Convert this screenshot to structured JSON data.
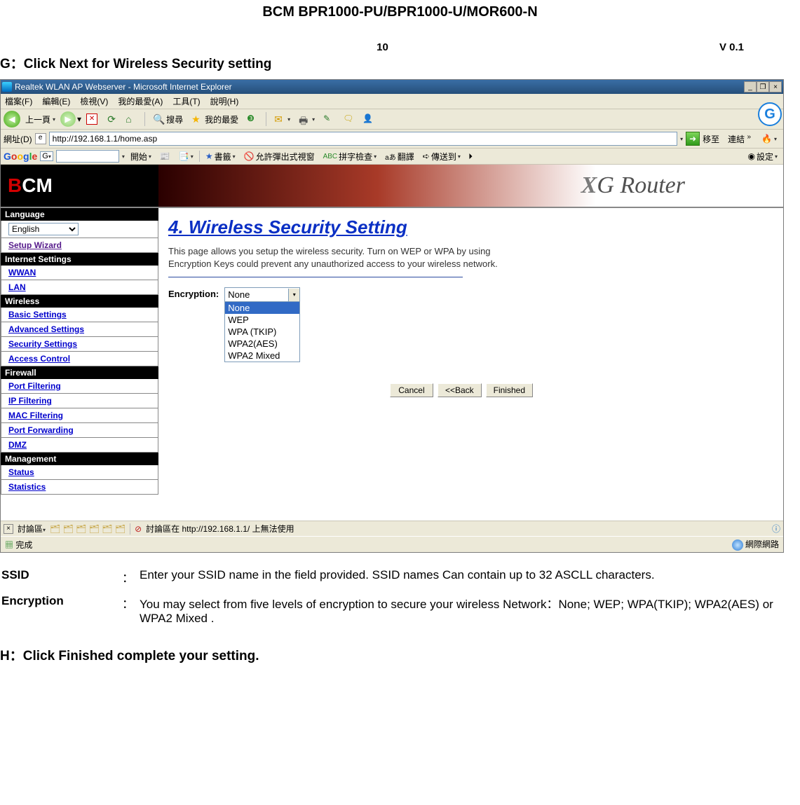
{
  "doc": {
    "header": "BCM    BPR1000-PU/BPR1000-U/MOR600-N",
    "page_num": "10",
    "version": "V 0.1",
    "section_g": "G：Click Next for Wireless Security setting",
    "section_h": "H：Click Finished complete your setting."
  },
  "ie": {
    "title": "Realtek WLAN AP Webserver - Microsoft Internet Explorer",
    "menus": {
      "file": "檔案(F)",
      "edit": "編輯(E)",
      "view": "檢視(V)",
      "fav": "我的最愛(A)",
      "tools": "工具(T)",
      "help": "說明(H)"
    },
    "toolbar": {
      "back": "上一頁",
      "search": "搜尋",
      "favorites": "我的最愛"
    },
    "address_label": "網址(D)",
    "address_value": "http://192.168.1.1/home.asp",
    "go_label": "移至",
    "links_label": "連結",
    "google": {
      "brand_b1": "G",
      "brand_r": "o",
      "brand_y": "o",
      "brand_b2": "g",
      "brand_g": "l",
      "brand_r2": "e",
      "start": "開始",
      "bookmarks": "書籤",
      "popup": "允許彈出式視窗",
      "spell": "拼字檢查",
      "translate": "翻譯",
      "sendto": "傳送到",
      "settings": "設定"
    }
  },
  "banner": {
    "logo_prefix": "B",
    "logo_rest": "CM",
    "product": "XG Router"
  },
  "sidebar": {
    "language_head": "Language",
    "language_value": "English",
    "setup_wizard": "Setup Wizard",
    "internet_head": "Internet Settings",
    "wwan": "WWAN",
    "lan": "LAN",
    "wireless_head": "Wireless",
    "basic": "Basic Settings",
    "advanced": "Advanced Settings",
    "security": "Security Settings",
    "access": "Access Control",
    "firewall_head": "Firewall",
    "portf": "Port Filtering",
    "ipf": "IP Filtering",
    "macf": "MAC Filtering",
    "portfwd": "Port Forwarding",
    "dmz": "DMZ",
    "mgmt_head": "Management",
    "status": "Status",
    "stats": "Statistics"
  },
  "panel": {
    "title": "4. Wireless Security Setting",
    "desc": "This page allows you setup the wireless security. Turn on WEP or WPA by using Encryption Keys could prevent any unauthorized access to your wireless network.",
    "enc_label": "Encryption:",
    "enc_selected": "None",
    "enc_options": [
      "None",
      "WEP",
      "WPA (TKIP)",
      "WPA2(AES)",
      "WPA2 Mixed"
    ],
    "btn_cancel": "Cancel",
    "btn_back": "<<Back",
    "btn_finished": "Finished"
  },
  "bottom": {
    "discuss_label": "討論區",
    "discuss_msg": "討論區在 http://192.168.1.1/ 上無法使用",
    "status_done": "完成",
    "status_net": "網際網路"
  },
  "defs": {
    "ssid_term": "SSID",
    "ssid_val": "Enter your SSID name in the field provided. SSID names Can contain up to 32 ASCLL characters.",
    "enc_term": "Encryption",
    "enc_val": "You may select from five levels of encryption to secure your wireless Network：None; WEP; WPA(TKIP); WPA2(AES) or WPA2 Mixed ."
  }
}
